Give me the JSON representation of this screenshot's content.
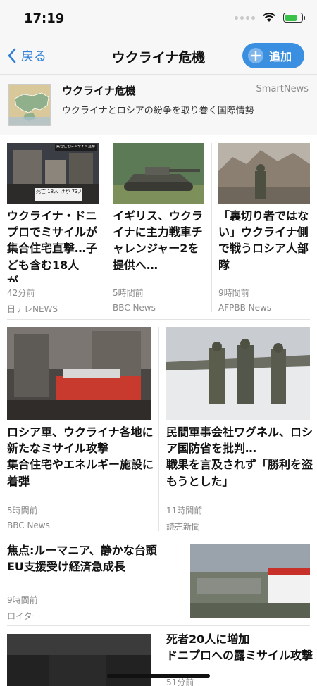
{
  "status_bar": {
    "time": "17:19"
  },
  "nav": {
    "back_label": "戻る",
    "title": "ウクライナ危機",
    "add_label": "追加"
  },
  "topic": {
    "title": "ウクライナ危機",
    "source": "SmartNews",
    "description": "ウクライナとロシアの紛争を取り巻く国際情勢"
  },
  "row1": [
    {
      "headline": "ウクライナ・ドニプロでミサイルが集合住宅直撃…子ども含む18人が…",
      "time": "42分前",
      "source": "日テレNEWS",
      "image_caption": "集合住宅にミサイル直撃 18人死亡",
      "image_counts": "死亡 18人 けが 73人"
    },
    {
      "headline": "イギリス、ウクライナに主力戦車チャレンジャー2を提供へ…",
      "time": "5時間前",
      "source": "BBC News"
    },
    {
      "headline": "「裏切り者ではない」ウクライナ側で戦うロシア人部隊",
      "time": "9時間前",
      "source": "AFPBB News"
    }
  ],
  "row2": [
    {
      "headline": "ロシア軍、ウクライナ各地に新たなミサイル攻撃\n集合住宅やエネルギー施設に着弾",
      "time": "5時間前",
      "source": "BBC News"
    },
    {
      "headline": "民間軍事会社ワグネル、ロシア国防省を批判…\n戦果を言及されず「勝利を盗もうとした」",
      "time": "11時間前",
      "source": "読売新聞"
    }
  ],
  "row3": {
    "headline": "焦点:ルーマニア、静かな台頭\nEU支援受け経済急成長",
    "time": "9時間前",
    "source": "ロイター"
  },
  "row4": {
    "headline": "死者20人に増加\nドニプロへの露ミサイル攻撃",
    "time": "51分前"
  }
}
